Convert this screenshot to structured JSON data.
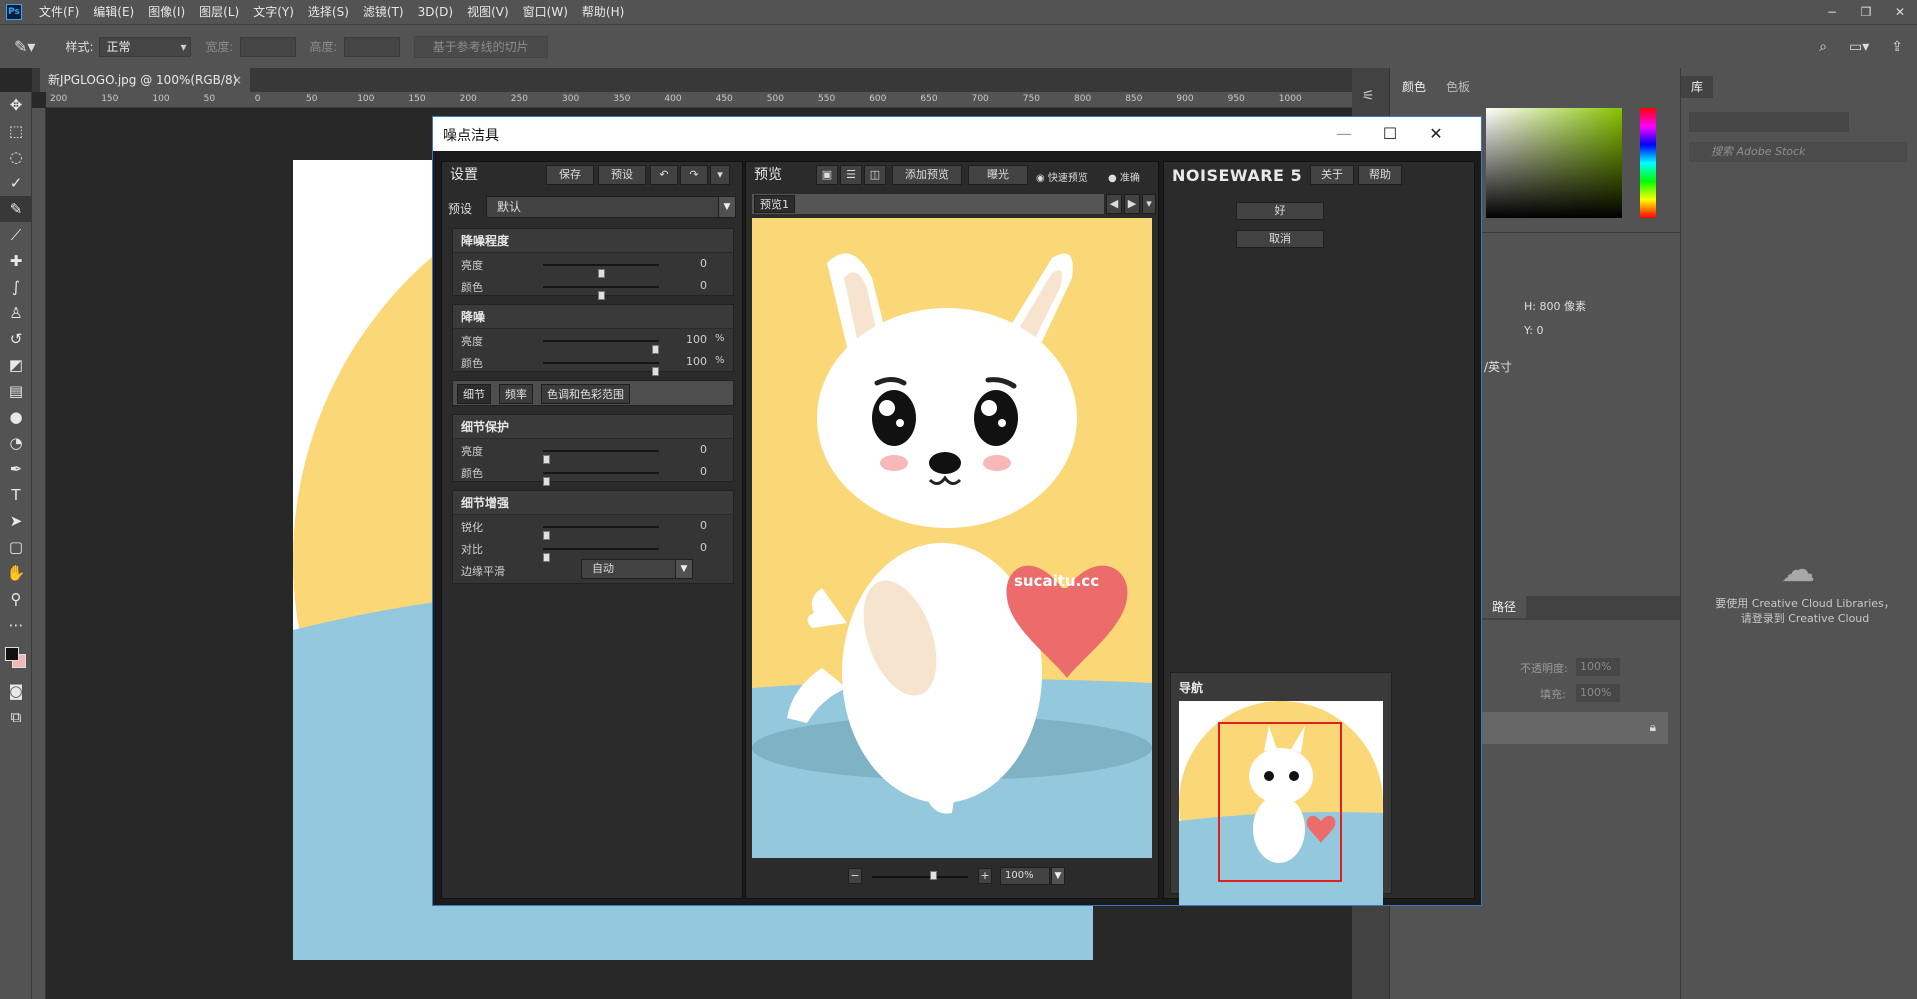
{
  "app": {
    "logo": "Ps",
    "menus": [
      "文件(F)",
      "编辑(E)",
      "图像(I)",
      "图层(L)",
      "文字(Y)",
      "选择(S)",
      "滤镜(T)",
      "3D(D)",
      "视图(V)",
      "窗口(W)",
      "帮助(H)"
    ],
    "window_controls": [
      "−",
      "❐",
      "✕"
    ]
  },
  "options_bar": {
    "style_label": "样式:",
    "style_value": "正常",
    "width_label": "宽度:",
    "height_label": "高度:",
    "slice_button": "基于参考线的切片"
  },
  "document": {
    "tab_title": "新JPGLOGO.jpg @ 100%(RGB/8)",
    "tab_close": "×",
    "ruler_ticks": [
      "200",
      "150",
      "100",
      "50",
      "0",
      "50",
      "100",
      "150",
      "200",
      "250",
      "300",
      "350",
      "400",
      "450",
      "500",
      "550",
      "600",
      "650",
      "700",
      "750",
      "800",
      "850",
      "900",
      "950",
      "1000"
    ]
  },
  "right_panels": {
    "color_tabs": [
      "颜色",
      "色板"
    ],
    "library_tab": "库",
    "library_search_placeholder": "搜索 Adobe Stock",
    "properties_h": "H:  800 像素",
    "properties_y": "Y:  0",
    "properties_unit": "/英寸",
    "layers_tab": "路径",
    "opacity_label": "不透明度:",
    "opacity_value": "100%",
    "fill_label": "填充:",
    "fill_value": "100%",
    "cc_message_line1": "要使用 Creative Cloud Libraries，",
    "cc_message_line2": "请登录到 Creative Cloud"
  },
  "dialog": {
    "title": "噪点洁具",
    "settings": {
      "header": "设置",
      "save_btn": "保存",
      "preset_btn": "预设",
      "preset_label": "预设",
      "preset_value": "默认",
      "noise_level": {
        "title": "降噪程度",
        "rows": [
          {
            "label": "亮度",
            "value": "0",
            "unit": "",
            "pos": 0.5
          },
          {
            "label": "颜色",
            "value": "0",
            "unit": "",
            "pos": 0.5
          }
        ]
      },
      "noise_reduction": {
        "title": "降噪",
        "rows": [
          {
            "label": "亮度",
            "value": "100",
            "unit": "%",
            "pos": 1.0
          },
          {
            "label": "颜色",
            "value": "100",
            "unit": "%",
            "pos": 1.0
          }
        ]
      },
      "tabs": [
        "细节",
        "频率",
        "色调和色彩范围"
      ],
      "detail_protection": {
        "title": "细节保护",
        "rows": [
          {
            "label": "亮度",
            "value": "0",
            "unit": "",
            "pos": 0.0
          },
          {
            "label": "颜色",
            "value": "0",
            "unit": "",
            "pos": 0.0
          }
        ]
      },
      "detail_enhancement": {
        "title": "细节增强",
        "rows": [
          {
            "label": "锐化",
            "value": "0",
            "unit": "",
            "pos": 0.0
          },
          {
            "label": "对比",
            "value": "0",
            "unit": "",
            "pos": 0.0
          }
        ],
        "edge_label": "边缘平滑",
        "edge_value": "自动"
      }
    },
    "preview": {
      "header": "预览",
      "add_preview_btn": "添加预览",
      "exposure_btn": "曝光",
      "fast_preview": "快速预览",
      "accurate": "准确",
      "tab_label": "预览1",
      "zoom_minus": "−",
      "zoom_plus": "+",
      "zoom_value": "100%",
      "zoom_pos": 0.65,
      "image_watermark": "sucaitu.cc"
    },
    "right": {
      "brand": "NOISEWARE 5",
      "about_btn": "关于",
      "help_btn": "帮助",
      "ok_btn": "好",
      "cancel_btn": "取消",
      "navigator_label": "导航"
    }
  }
}
